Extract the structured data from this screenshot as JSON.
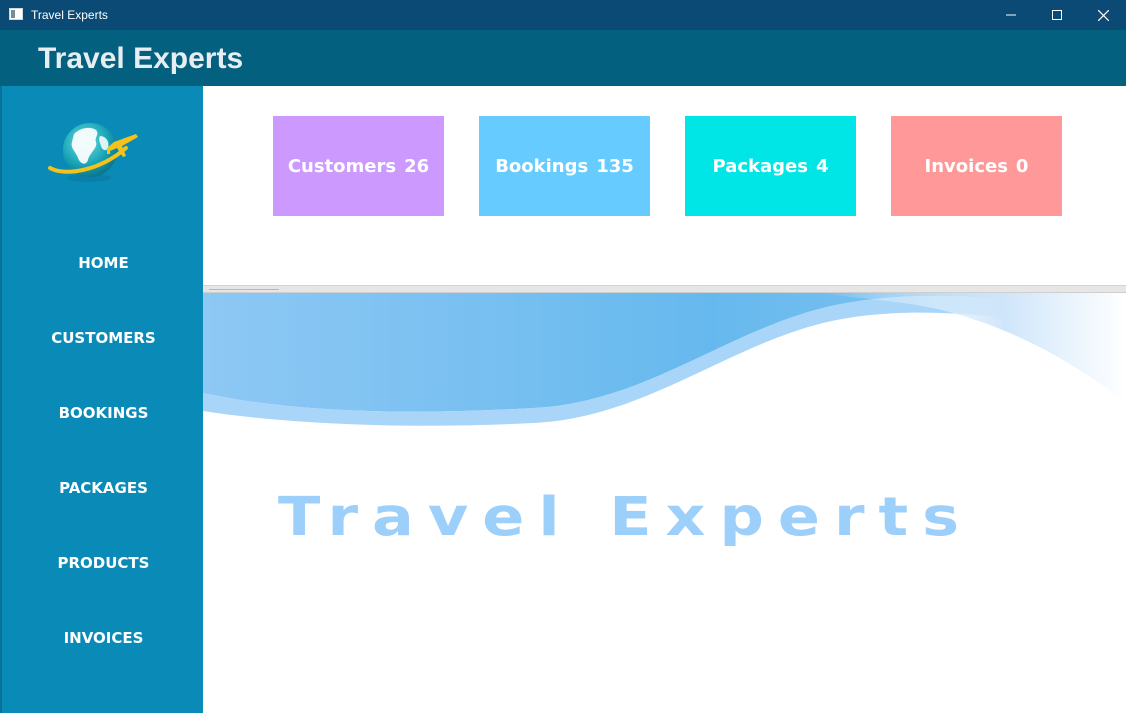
{
  "window": {
    "title": "Travel Experts",
    "controls": [
      "minimize-icon",
      "maximize-icon",
      "close-icon"
    ]
  },
  "header": {
    "title": "Travel Experts"
  },
  "sidebar": {
    "logo_icon": "globe-airplane-icon",
    "items": [
      {
        "label": "HOME"
      },
      {
        "label": "CUSTOMERS"
      },
      {
        "label": "BOOKINGS"
      },
      {
        "label": "PACKAGES"
      },
      {
        "label": "PRODUCTS"
      },
      {
        "label": "INVOICES"
      }
    ]
  },
  "tiles": [
    {
      "label": "Customers",
      "count": "26",
      "color": "#cc99ff"
    },
    {
      "label": "Bookings",
      "count": "135",
      "color": "#66ccff"
    },
    {
      "label": "Packages",
      "count": "4",
      "color": "#00e6e6"
    },
    {
      "label": "Invoices",
      "count": "0",
      "color": "#ff9999"
    }
  ],
  "banner": {
    "text": "Travel Experts"
  },
  "colors": {
    "titlebar": "#0a4a75",
    "header": "#04607f",
    "sidebar": "#0a8bb7",
    "banner_text": "#9ccff9"
  }
}
